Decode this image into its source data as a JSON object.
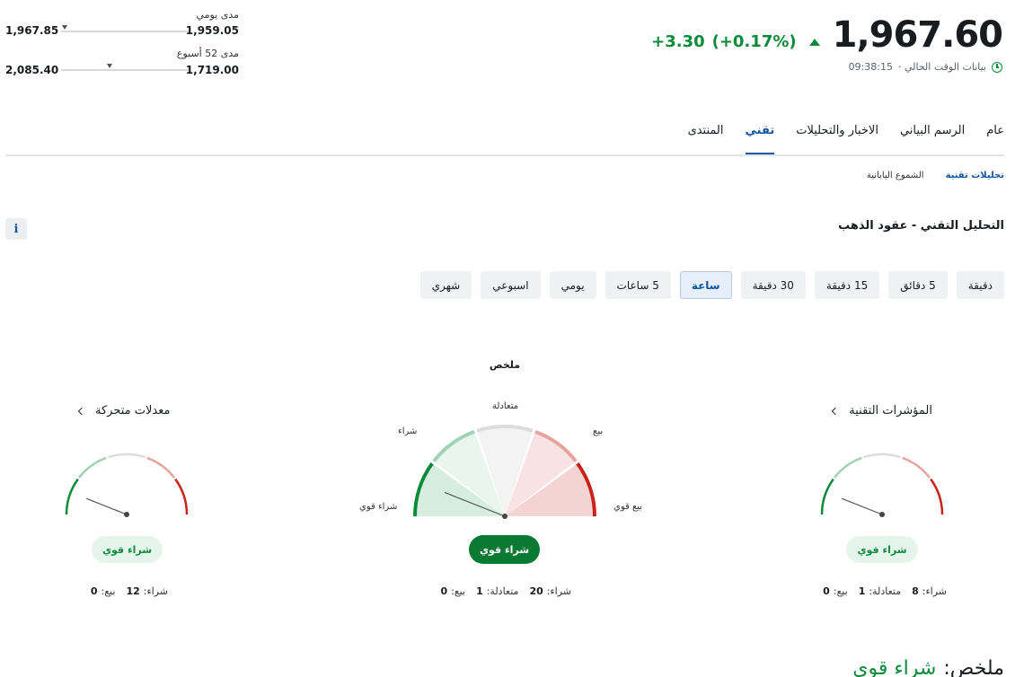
{
  "quote": {
    "last": "1,967.60",
    "change": "+3.30",
    "change_pct": "(+0.17%)",
    "time": "09:38:15",
    "time_label": "بيانات الوقت الحالي ·"
  },
  "ranges": {
    "daily": {
      "label": "مدى يومي",
      "low": "1,959.05",
      "high": "1,967.85",
      "position": 0.97
    },
    "week52": {
      "label": "مدى 52 أسبوع",
      "low": "1,719.00",
      "high": "2,085.40",
      "position": 0.62
    }
  },
  "tabs": [
    {
      "label": "عام",
      "active": false
    },
    {
      "label": "الرسم البياني",
      "active": false
    },
    {
      "label": "الاخبار والتحليلات",
      "active": false
    },
    {
      "label": "تقني",
      "active": true
    },
    {
      "label": "المنتدى",
      "active": false
    }
  ],
  "subtabs": [
    {
      "label": "تحليلات تقنية",
      "active": true
    },
    {
      "label": "الشموع اليابانية",
      "active": false
    }
  ],
  "section_title": "التحليل التقني - عقود الذهب",
  "info_label": "i",
  "timeframes": [
    {
      "label": "دقيقة",
      "active": false
    },
    {
      "label": "5 دقائق",
      "active": false
    },
    {
      "label": "15 دقيقة",
      "active": false
    },
    {
      "label": "30 دقيقة",
      "active": false
    },
    {
      "label": "ساعة",
      "active": true
    },
    {
      "label": "5 ساعات",
      "active": false
    },
    {
      "label": "يومي",
      "active": false
    },
    {
      "label": "اسبوعي",
      "active": false
    },
    {
      "label": "شهري",
      "active": false
    }
  ],
  "summary_gauge": {
    "title": "ملخص",
    "labels": {
      "neutral": "متعادلة",
      "buy": "شراء",
      "sell": "بيع",
      "strong_buy": "شراء قوي",
      "strong_sell": "بيع قوي"
    },
    "verdict": "شراء قوي",
    "needle": 0.12,
    "counts": {
      "buy_label": "شراء:",
      "buy": "20",
      "neutral_label": "متعادلة:",
      "neutral": "1",
      "sell_label": "بيع:",
      "sell": "0"
    }
  },
  "indicators_gauge": {
    "title": "المؤشرات التقنية",
    "verdict": "شراء قوي",
    "needle": 0.12,
    "counts": {
      "buy_label": "شراء:",
      "buy": "8",
      "neutral_label": "متعادلة:",
      "neutral": "1",
      "sell_label": "بيع:",
      "sell": "0"
    }
  },
  "ma_gauge": {
    "title": "معدلات متحركة",
    "verdict": "شراء قوي",
    "needle": 0.12,
    "counts": {
      "buy_label": "شراء:",
      "buy": "12",
      "sell_label": "بيع:",
      "sell": "0"
    }
  },
  "footer": {
    "label": "ملخص:",
    "value": "شراء قوي"
  },
  "colors": {
    "green": "#0a8a3a",
    "dark_green": "#0a7a33",
    "red": "#c8221a",
    "light_green": "#9fd3b3",
    "light_red": "#e7a3a0",
    "grey": "#dcdcdc",
    "accent": "#1256a0"
  }
}
